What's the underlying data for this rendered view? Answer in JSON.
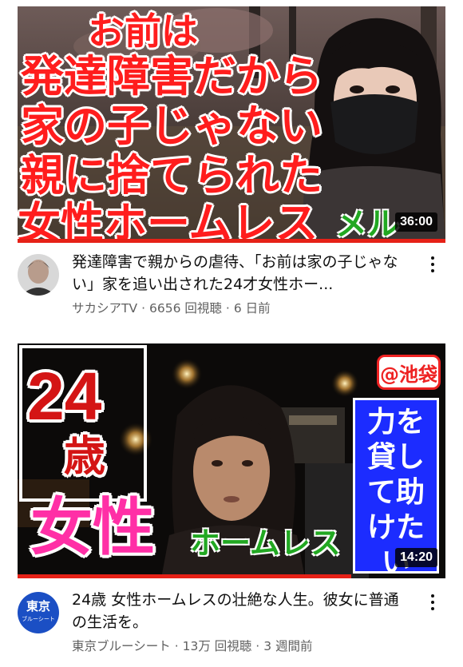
{
  "colors": {
    "progress": "#e62117",
    "overlay_red": "#ff1d1d",
    "overlay_pink": "#ff2fa6",
    "overlay_green": "#22a822",
    "overlay_blue_box": "#1c2cff",
    "meta_text": "#606060"
  },
  "videos": [
    {
      "thumbnail_lines": [
        "お前は",
        "発達障害だから",
        "家の子じゃない",
        "親に捨てられた",
        "女性ホームレス"
      ],
      "thumbnail_name": "メル",
      "duration": "36:00",
      "watched_fraction": 1.0,
      "title": "発達障害で親からの虐待、「お前は家の子じゃない」家を追い出された24才女性ホー...",
      "channel": "サカシアTV",
      "views": "6656 回視聴",
      "age": "6 日前",
      "avatar_icon": "channel-avatar-photo"
    },
    {
      "thumbnail_age": "24",
      "thumbnail_age_unit": "歳",
      "thumbnail_gender": "女性",
      "thumbnail_homeless": "ホームレス",
      "thumbnail_place": "@池袋",
      "thumbnail_help": "力を貸して助けたい",
      "duration": "14:20",
      "watched_fraction": 0.78,
      "title": "24歳 女性ホームレスの壮絶な人生。彼女に普通の生活を。",
      "channel": "東京ブルーシート",
      "views": "13万 回視聴",
      "age": "3 週間前",
      "avatar_text": "東京",
      "avatar_subtext": "ブルーシート"
    }
  ]
}
